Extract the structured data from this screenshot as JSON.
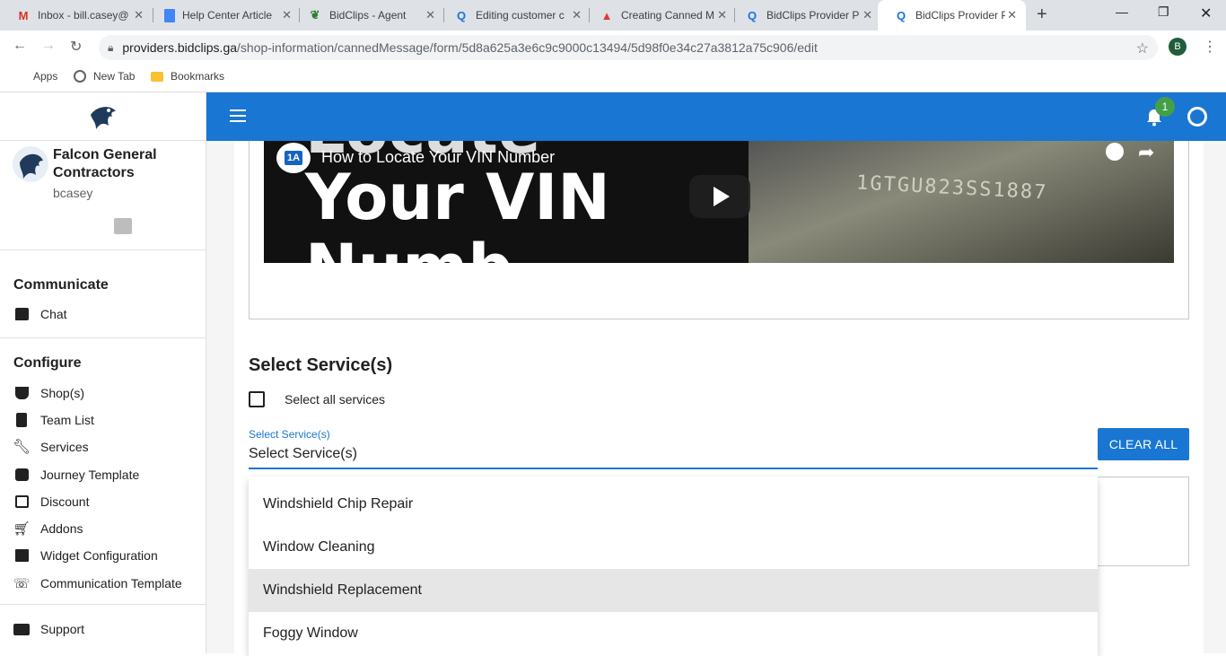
{
  "browser": {
    "tabs": [
      {
        "label": "Inbox - bill.casey@",
        "icon": "gmail-icon"
      },
      {
        "label": "Help Center Article",
        "icon": "docs-icon"
      },
      {
        "label": "BidClips - Agent",
        "icon": "bidclips-icon"
      },
      {
        "label": "Editing customer c",
        "icon": "search-doc-icon"
      },
      {
        "label": "Creating Canned M",
        "icon": "drive-icon"
      },
      {
        "label": "BidClips Provider P",
        "icon": "bidclips-q-icon"
      },
      {
        "label": "BidClips Provider P",
        "icon": "bidclips-q-icon"
      }
    ],
    "url_host": "providers.bidclips.ga",
    "url_path": "/shop-information/cannedMessage/form/5d8a625a3e6c9c9000c13494/5d98f0e34c27a3812a75c906/edit",
    "profile_initial": "B",
    "bookmarks": [
      "Apps",
      "New Tab",
      "Bookmarks"
    ]
  },
  "sidebar": {
    "company_name": "Falcon General Contractors",
    "username": "bcasey",
    "sections": [
      {
        "title": "Communicate",
        "items": [
          {
            "label": "Chat",
            "icon": "chat-icon"
          }
        ]
      },
      {
        "title": "Configure",
        "items": [
          {
            "label": "Shop(s)",
            "icon": "basket-icon"
          },
          {
            "label": "Team List",
            "icon": "clipboard-icon"
          },
          {
            "label": "Services",
            "icon": "wrench-icon"
          },
          {
            "label": "Journey Template",
            "icon": "camera-icon"
          },
          {
            "label": "Discount",
            "icon": "gift-icon"
          },
          {
            "label": "Addons",
            "icon": "cart-plus-icon"
          },
          {
            "label": "Widget Configuration",
            "icon": "widget-icon"
          },
          {
            "label": "Communication Template",
            "icon": "phone-icon"
          }
        ]
      }
    ],
    "support_label": "Support"
  },
  "topbar": {
    "notification_count": "1",
    "accent": "#1976d2"
  },
  "video": {
    "title": "How to Locate Your VIN Number",
    "channel_badge": "1A",
    "overlay_line1": "Your VIN",
    "overlay_top": "Locate",
    "overlay_line2": "Numb",
    "stamp_text": "1GTGU823SS1887"
  },
  "form": {
    "section_title": "Select Service(s)",
    "select_all_label": "Select all services",
    "field_label": "Select Service(s)",
    "field_value": "Select Service(s)",
    "clear_all_label": "CLEAR ALL",
    "options": [
      "Windshield Chip Repair",
      "Window Cleaning",
      "Windshield Replacement",
      "Foggy Window"
    ],
    "highlighted_option": "Windshield Replacement"
  }
}
